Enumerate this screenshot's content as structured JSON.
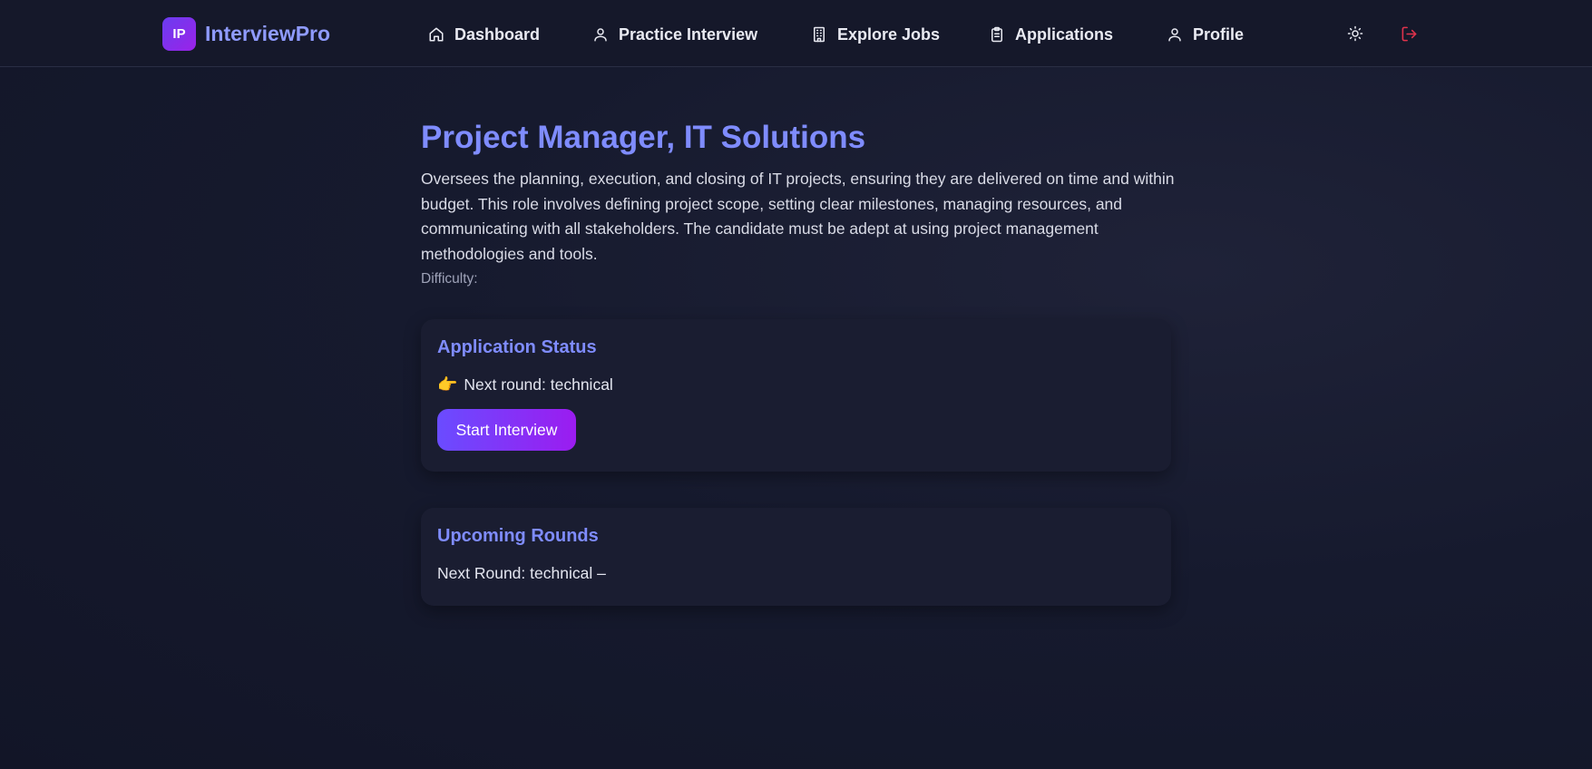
{
  "brand": {
    "logo_text": "IP",
    "name": "InterviewPro"
  },
  "nav": {
    "items": [
      {
        "label": "Dashboard",
        "icon": "home-icon"
      },
      {
        "label": "Practice Interview",
        "icon": "user-icon"
      },
      {
        "label": "Explore Jobs",
        "icon": "building-icon"
      },
      {
        "label": "Applications",
        "icon": "clipboard-icon"
      },
      {
        "label": "Profile",
        "icon": "user-icon"
      }
    ],
    "theme_icon": "sun-icon",
    "logout_icon": "logout-icon"
  },
  "job": {
    "title": "Project Manager, IT Solutions",
    "description": "Oversees the planning, execution, and closing of IT projects, ensuring they are delivered on time and within budget. This role involves defining project scope, setting clear milestones, managing resources, and communicating with all stakeholders. The candidate must be adept at using project management methodologies and tools.",
    "difficulty_label": "Difficulty:"
  },
  "application_status": {
    "title": "Application Status",
    "emoji": "👉",
    "next_round_text": "Next round: technical",
    "start_button_label": "Start Interview"
  },
  "upcoming_rounds": {
    "title": "Upcoming Rounds",
    "next_round_text": "Next Round: technical –"
  },
  "colors": {
    "accent": "#7f8cff",
    "button_gradient_start": "#6a4cff",
    "button_gradient_end": "#9b1cf0",
    "logout": "#e0334c"
  }
}
